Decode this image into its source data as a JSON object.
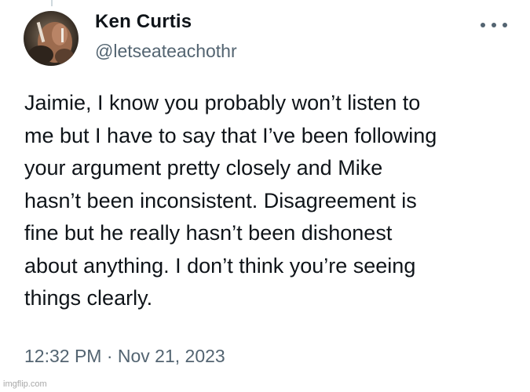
{
  "author": {
    "display_name": "Ken Curtis",
    "handle": "@letseateachothr",
    "avatar_icon": "user-avatar"
  },
  "more_icon": "more-horizontal-icon",
  "tweet": {
    "lines": [
      "Jaimie, I know you probably won’t listen to",
      "me but I have to say that I’ve been following",
      "your argument pretty closely and Mike",
      "hasn’t been inconsistent. Disagreement is",
      "fine but he really hasn’t been dishonest",
      "about anything. I don’t think you’re seeing",
      "things clearly."
    ],
    "timestamp": "12:32 PM · Nov 21, 2023"
  },
  "watermark": "imgflip.com",
  "colors": {
    "text_primary": "#0f1419",
    "text_secondary": "#536471",
    "background": "#ffffff"
  }
}
